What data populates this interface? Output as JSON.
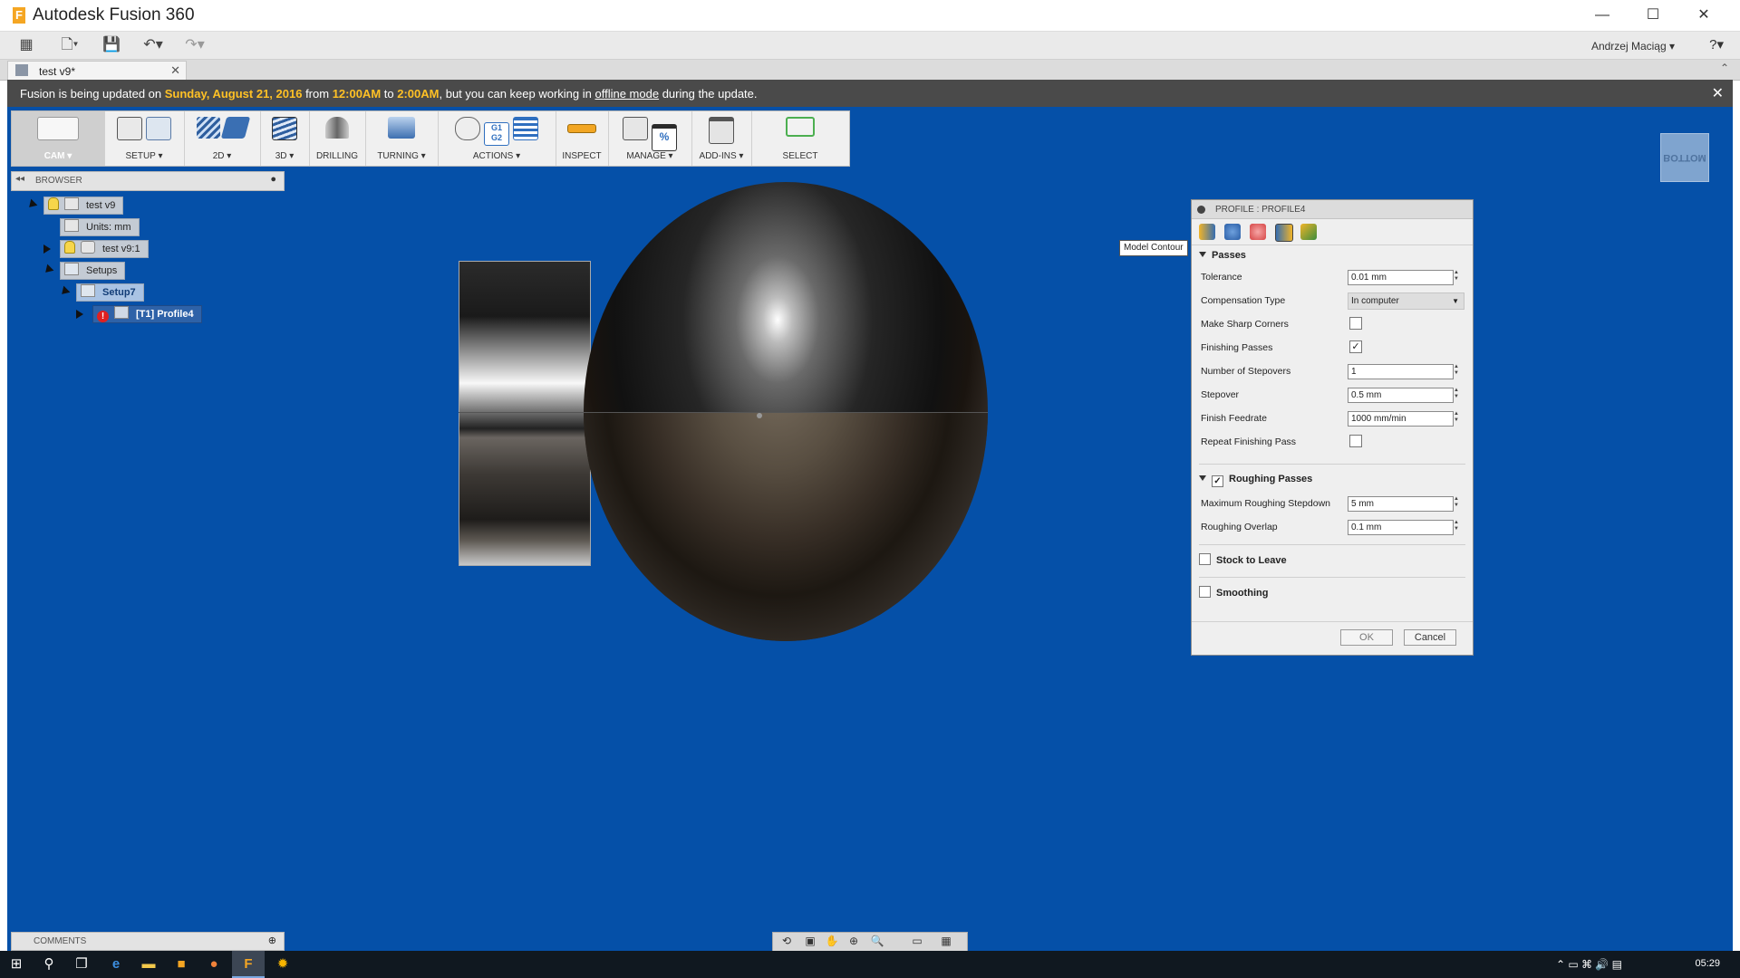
{
  "window": {
    "title": "Autodesk Fusion 360",
    "minimize": "—",
    "maximize": "☐",
    "close": "✕"
  },
  "quick_access": {
    "user": "Andrzej Maciąg ▾",
    "help": "?▾"
  },
  "document_tab": {
    "label": "test v9*",
    "close": "✕"
  },
  "notice": {
    "prefix": "Fusion is being updated on ",
    "date": "Sunday, August 21, 2016",
    "from": " from ",
    "start": "12:00AM",
    "to": " to ",
    "end": "2:00AM",
    "middle": ", but you can keep working in ",
    "link": "offline mode",
    "suffix": " during the update.",
    "close": "✕"
  },
  "toolbar": {
    "workspace": "CAM ▾",
    "groups": [
      {
        "label": "SETUP ▾"
      },
      {
        "label": "2D ▾"
      },
      {
        "label": "3D ▾"
      },
      {
        "label": "DRILLING"
      },
      {
        "label": "TURNING ▾"
      },
      {
        "label": "ACTIONS ▾"
      },
      {
        "label": "INSPECT"
      },
      {
        "label": "MANAGE ▾"
      },
      {
        "label": "ADD-INS ▾"
      },
      {
        "label": "SELECT"
      }
    ],
    "actions_icon_text": "G1\nG2",
    "manage_icon_text": "%"
  },
  "browser": {
    "title": "BROWSER",
    "collapse": "◂◂",
    "options": "●",
    "nodes": {
      "root": "test v9",
      "units": "Units: mm",
      "component": "test v9:1",
      "setups": "Setups",
      "setup": "Setup7",
      "operation": "[T1] Profile4",
      "error": "!"
    }
  },
  "viewcube": {
    "label": "BOTTOM"
  },
  "tooltip": {
    "text": "Model Contour"
  },
  "dialog": {
    "title": "PROFILE : PROFILE4",
    "passes": {
      "heading": "Passes",
      "tolerance_label": "Tolerance",
      "tolerance_value": "0.01 mm",
      "compensation_label": "Compensation Type",
      "compensation_value": "In computer",
      "sharp_corners_label": "Make Sharp Corners",
      "finishing_passes_label": "Finishing Passes",
      "stepovers_label": "Number of Stepovers",
      "stepovers_value": "1",
      "stepover_label": "Stepover",
      "stepover_value": "0.5 mm",
      "feedrate_label": "Finish Feedrate",
      "feedrate_value": "1000 mm/min",
      "repeat_label": "Repeat Finishing Pass"
    },
    "roughing": {
      "heading": "Roughing Passes",
      "stepdown_label": "Maximum Roughing Stepdown",
      "stepdown_value": "5 mm",
      "overlap_label": "Roughing Overlap",
      "overlap_value": "0.1 mm"
    },
    "stock_to_leave": "Stock to Leave",
    "smoothing": "Smoothing",
    "ok": "OK",
    "cancel": "Cancel",
    "checkmark": "✓"
  },
  "comments": {
    "title": "COMMENTS",
    "add": "⊕"
  },
  "taskbar": {
    "clock": "05:29",
    "start": "⊞",
    "search": "⚲"
  },
  "colors": {
    "viewport": "#0550a8",
    "notice_highlight": "#ffc125",
    "error_badge": "#e02020"
  }
}
